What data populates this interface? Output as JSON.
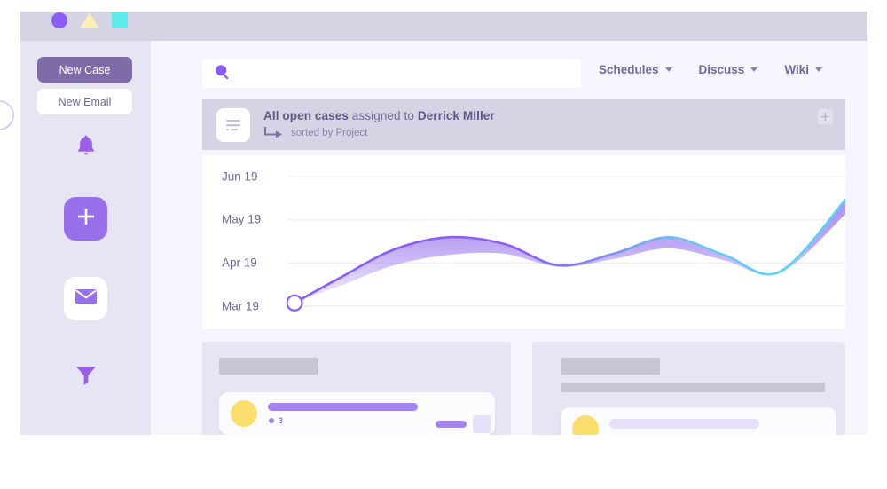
{
  "window": {
    "decor_shapes": [
      {
        "name": "circle",
        "color": "#8b5cf6"
      },
      {
        "name": "triangle",
        "color": "#fdeeb5"
      },
      {
        "name": "square",
        "color": "#5ceaea"
      }
    ]
  },
  "sidebar": {
    "new_case_label": "New Case",
    "new_email_label": "New Email",
    "icons": [
      {
        "name": "bell-icon",
        "label": "Notifications"
      },
      {
        "name": "plus-icon",
        "label": "Create"
      },
      {
        "name": "envelope-icon",
        "label": "Mail"
      },
      {
        "name": "filter-icon",
        "label": "Filter"
      }
    ]
  },
  "search": {
    "value": "",
    "placeholder": "",
    "icon": "search-icon"
  },
  "topnav": {
    "items": [
      {
        "label": "Schedules"
      },
      {
        "label": "Discuss"
      },
      {
        "label": "Wiki"
      }
    ]
  },
  "banner": {
    "icon": "list-document-icon",
    "title_strong": "All open cases",
    "title_mid": " assigned to ",
    "title_person": "Derrick MIller",
    "subtitle": "sorted by Project",
    "subtitle_icon": "arrow-turn-right-icon",
    "add_button_icon": "plus-icon"
  },
  "chart_data": {
    "type": "line",
    "title": "",
    "xlabel": "",
    "ylabel": "",
    "grid": true,
    "legend": false,
    "categories": [
      "Mar 19",
      "Apr 19",
      "May 19",
      "Jun 19"
    ],
    "ytick_labels_top_to_bottom": [
      "Jun 19",
      "May 19",
      "Apr 19",
      "Mar 19"
    ],
    "marker_start": {
      "x": 0,
      "y": 0,
      "style": "open-circle",
      "color": "#8b5cf6"
    },
    "line_gradient": {
      "from": "#8b5cf6",
      "to": "#56d6f2"
    },
    "fill_color": "#a98cf0",
    "series": [
      {
        "name": "upper",
        "x": [
          0,
          8,
          18,
          28,
          38,
          48,
          58,
          68,
          78,
          88,
          100
        ],
        "values": [
          0.05,
          0.42,
          0.86,
          1.05,
          0.95,
          0.62,
          0.8,
          1.05,
          0.78,
          0.52,
          1.62
        ]
      },
      {
        "name": "lower",
        "x": [
          0,
          8,
          18,
          28,
          38,
          48,
          58,
          68,
          78,
          88,
          100
        ],
        "values": [
          0.05,
          0.3,
          0.62,
          0.78,
          0.8,
          0.6,
          0.72,
          0.88,
          0.7,
          0.5,
          1.4
        ]
      }
    ],
    "ylim": [
      0,
      3
    ],
    "xlim": [
      0,
      100
    ]
  },
  "cards": {
    "left": {
      "header_placeholder": "",
      "item": {
        "avatar": "user-avatar",
        "title_bar": "",
        "count_label": "3",
        "action_pill": "",
        "action_square": ""
      }
    },
    "right": {
      "header_placeholder": "",
      "subheader_placeholder": "",
      "item": {
        "avatar": "user-avatar",
        "title_bar": ""
      }
    }
  },
  "colors": {
    "accent_purple": "#8b5cf6",
    "accent_cyan": "#56d6f2",
    "sidebar_bg": "#e7e4f4",
    "canvas_bg": "#f6f4fd",
    "banner_bg": "#d6d3e5",
    "chrome_bg": "#d6d3e4",
    "text_muted": "#6f6a96",
    "avatar_yellow": "#fadf6e"
  }
}
